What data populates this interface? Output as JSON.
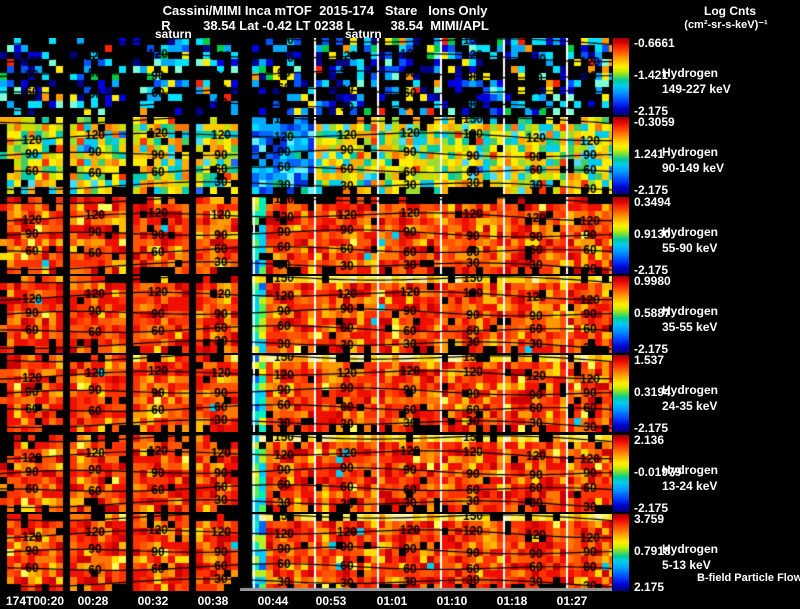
{
  "chart_data": {
    "type": "heatmap",
    "title": "Cassini/MIMI Inca mTOF  2015-174   Stare   Ions Only",
    "subtitle": "R         38.54 Lat -0.42 LT 0238 L          38.54  MIMI/APL",
    "colorbar_title": "Log Cnts",
    "colorbar_units": "(cm²-sr-s-keV)⁻¹",
    "orientation_markers": [
      "saturn",
      "saturn"
    ],
    "contour_levels": [
      150,
      120,
      90,
      60,
      30
    ],
    "x_axis": {
      "tick_labels": [
        "174T00:20",
        "00:28",
        "00:32",
        "00:38",
        "00:44",
        "00:53",
        "01:01",
        "01:10",
        "01:18",
        "01:27"
      ]
    },
    "panels": [
      {
        "species": "Hydrogen",
        "energy_range": "149-227 keV",
        "colorbar_ticks": [
          "-0.6661",
          "-1.421",
          "-2.175"
        ],
        "palette": "sparse-cold"
      },
      {
        "species": "Hydrogen",
        "energy_range": "90-149 keV",
        "colorbar_ticks": [
          "-0.3059",
          "1.241",
          "-2.175"
        ],
        "palette": "warm-mixed"
      },
      {
        "species": "Hydrogen",
        "energy_range": "55-90 keV",
        "colorbar_ticks": [
          "0.3494",
          "0.9130",
          "-2.175"
        ],
        "palette": "hot"
      },
      {
        "species": "Hydrogen",
        "energy_range": "35-55 keV",
        "colorbar_ticks": [
          "0.9980",
          "0.5887",
          "-2.175"
        ],
        "palette": "hot"
      },
      {
        "species": "Hydrogen",
        "energy_range": "24-35 keV",
        "colorbar_ticks": [
          "1.537",
          "0.3194",
          "-2.175"
        ],
        "palette": "hot"
      },
      {
        "species": "Hydrogen",
        "energy_range": "13-24 keV",
        "colorbar_ticks": [
          "2.136",
          "-0.01979",
          "-2.175"
        ],
        "palette": "hot"
      },
      {
        "species": "Hydrogen",
        "energy_range": "5-13 keV",
        "colorbar_ticks": [
          "3.759",
          "0.7918",
          "2.175"
        ],
        "palette": "hot",
        "annotation": "B-field Particle Flow"
      }
    ],
    "colors": {
      "background": "#000000",
      "text": "#ffffff",
      "separator": "#ffffff",
      "axis_strip": "#999999",
      "contour": "#000000"
    }
  }
}
